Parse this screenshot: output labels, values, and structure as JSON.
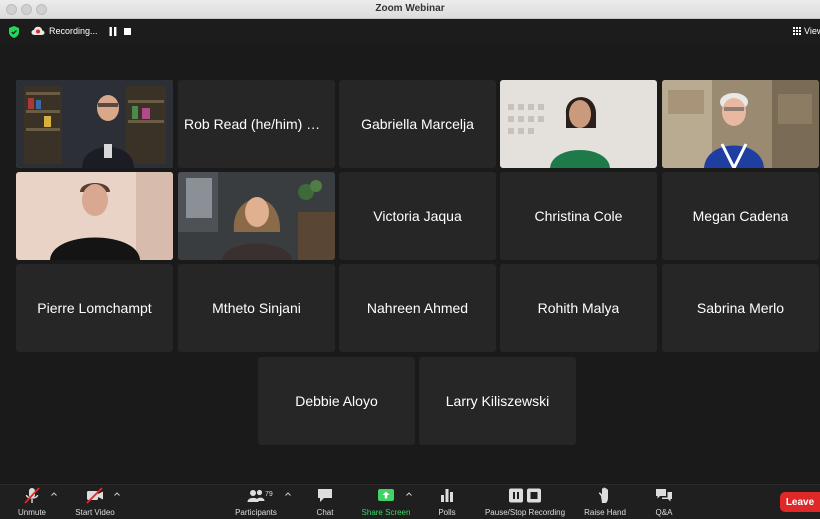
{
  "window": {
    "title": "Zoom Webinar"
  },
  "topbar": {
    "recording_label": "Recording...",
    "view_label": "View"
  },
  "participants": [
    {
      "name": "",
      "video": true,
      "active": true
    },
    {
      "name": "Rob Read (he/him) Plantasia",
      "video": false
    },
    {
      "name": "Gabriella Marcelja",
      "video": false
    },
    {
      "name": "",
      "video": true
    },
    {
      "name": "",
      "video": true
    },
    {
      "name": "",
      "video": true
    },
    {
      "name": "",
      "video": true
    },
    {
      "name": "Victoria Jaqua",
      "video": false
    },
    {
      "name": "Christina Cole",
      "video": false
    },
    {
      "name": "Megan Cadena",
      "video": false
    },
    {
      "name": "Pierre Lomchampt",
      "video": false
    },
    {
      "name": "Mtheto Sinjani",
      "video": false
    },
    {
      "name": "Nahreen Ahmed",
      "video": false
    },
    {
      "name": "Rohith Malya",
      "video": false
    },
    {
      "name": "Sabrina Merlo",
      "video": false
    },
    {
      "name": "Debbie Aloyo",
      "video": false
    },
    {
      "name": "Larry Kiliszewski",
      "video": false
    }
  ],
  "toolbar": {
    "unmute": "Unmute",
    "start_video": "Start Video",
    "participants": "Participants",
    "participants_count": "79",
    "chat": "Chat",
    "share_screen": "Share Screen",
    "polls": "Polls",
    "recording": "Pause/Stop Recording",
    "raise_hand": "Raise Hand",
    "qa": "Q&A",
    "leave": "Leave"
  },
  "colors": {
    "active_speaker": "#23d959",
    "share_green": "#3fd265",
    "leave_red": "#e02828",
    "tile_bg": "#262626"
  }
}
